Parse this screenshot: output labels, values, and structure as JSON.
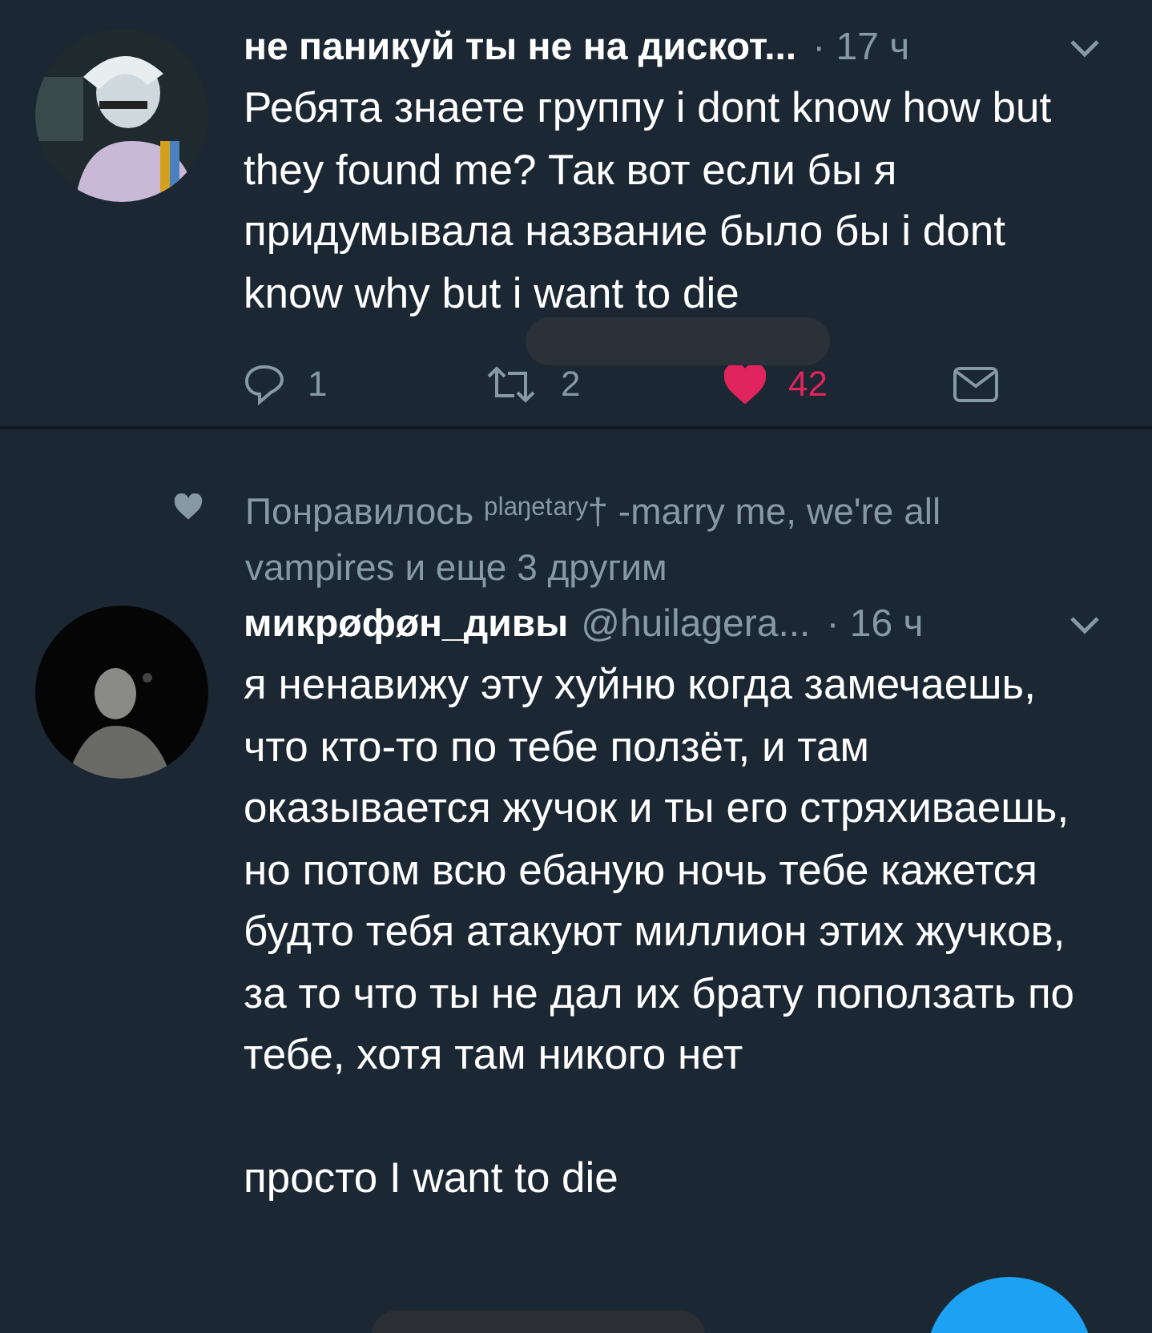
{
  "tweets": [
    {
      "avatar": {
        "kind": "picture"
      },
      "name": "не паникуй ты не на дискот...",
      "time": "· 17 ч",
      "body": [
        "Ребята знаете группу i dont know how but they found me? Так вот если бы я придумывала название было бы i dont know why but i want to die"
      ],
      "actions": {
        "replies": "1",
        "retweets": "2",
        "likes": "42",
        "liked": true
      }
    },
    {
      "liked_by": "Понравилось ᵖˡᵃᵑᵉᵗᵃʳʸ† -marry me, we're all vampires и еще 3 другим",
      "avatar": {
        "kind": "picture"
      },
      "name": "микрøфøн_дивы",
      "handle": "@huilagera...",
      "time": "· 16 ч",
      "body": [
        "я ненавижу эту хуйню когда замечаешь, что кто-то по тебе ползёт, и там оказывается жучок и ты его стряхиваешь, но потом всю ебаную ночь тебе кажется будто тебя атакуют миллион этих жучков, за то что ты не дал их брату поползать по тебе, хотя там никого нет",
        "просто I want to die"
      ]
    }
  ]
}
